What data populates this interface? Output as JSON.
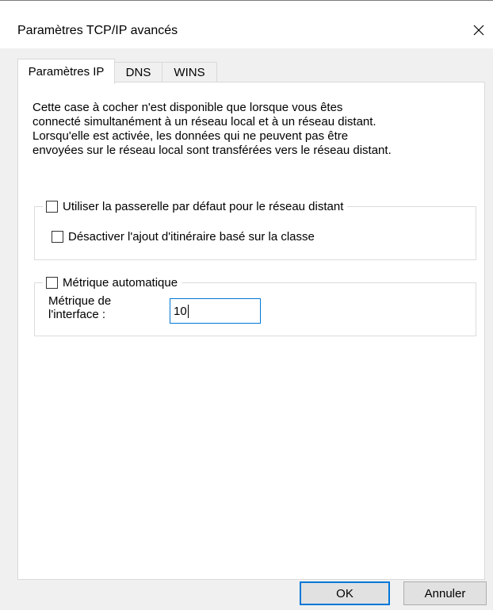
{
  "window": {
    "title": "Paramètres TCP/IP avancés"
  },
  "tabs": [
    {
      "label": "Paramètres IP",
      "active": true
    },
    {
      "label": "DNS",
      "active": false
    },
    {
      "label": "WINS",
      "active": false
    }
  ],
  "panel": {
    "description": "Cette case à cocher n'est disponible que lorsque vous êtes\nconnecté simultanément à un réseau local et à un réseau distant.\nLorsqu'elle est activée, les données qui ne peuvent pas être\nenvoyées sur le réseau local sont transférées vers le réseau distant.",
    "gateway_group": {
      "checkbox_label": "Utiliser la passerelle par défaut pour le réseau distant",
      "checked": false,
      "sub_checkbox_label": "Désactiver l'ajout d'itinéraire basé sur la classe",
      "sub_checked": false
    },
    "metric_group": {
      "checkbox_label": "Métrique automatique",
      "checked": false,
      "interface_metric_label": "Métrique de\nl'interface :",
      "interface_metric_value": "10"
    }
  },
  "buttons": {
    "ok_label": "OK",
    "cancel_label": "Annuler"
  }
}
